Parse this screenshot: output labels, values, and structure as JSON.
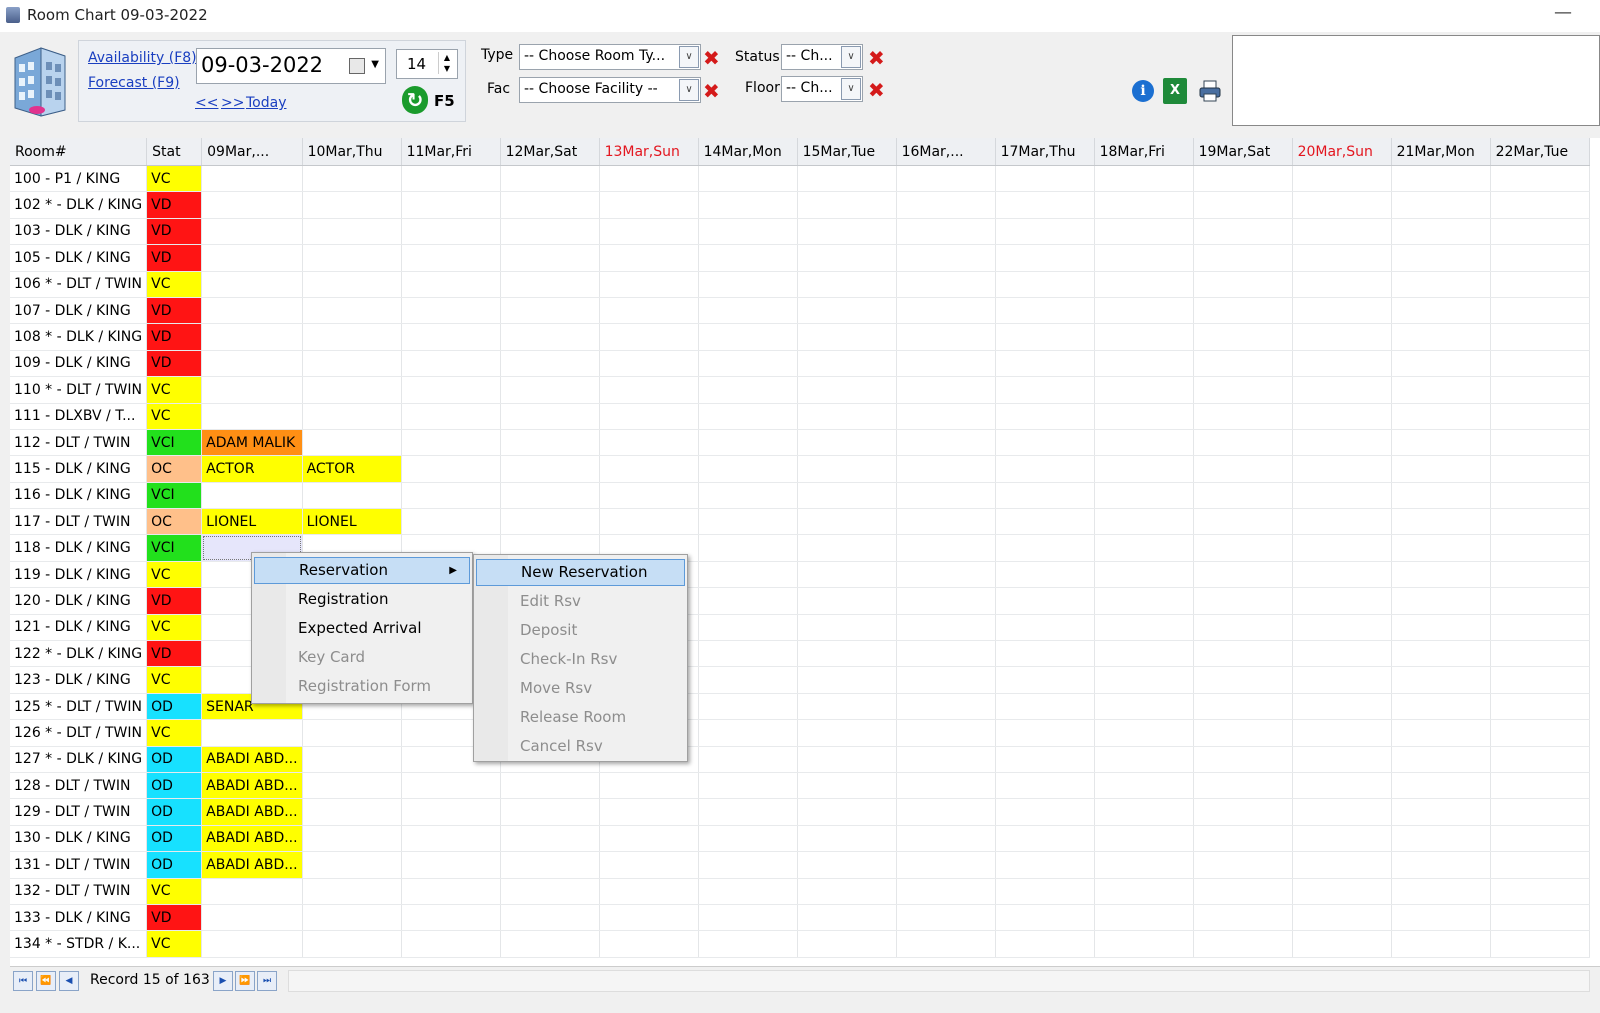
{
  "window": {
    "title": "Room Chart 09-03-2022"
  },
  "nav": {
    "availability": "Availability (F8)",
    "forecast": "Forecast (F9)",
    "prev": "<<",
    "next": ">>",
    "today": "Today",
    "date": "09-03-2022",
    "days": "14",
    "refresh_key": "F5"
  },
  "filters": {
    "type_label": "Type",
    "type_value": "-- Choose Room Ty...",
    "fac_label": "Fac",
    "fac_value": "-- Choose Facility --",
    "status_label": "Status",
    "status_value": "-- Ch...",
    "floor_label": "Floor",
    "floor_value": "-- Ch..."
  },
  "colors": {
    "VC": "#ffff00",
    "VD": "#ff1414",
    "VCI": "#22e01c",
    "OC": "#ffc08a",
    "OD": "#17e1ff",
    "guest_orange": "#ff8f14",
    "guest_yellow": "#ffff00",
    "weekend": "#e3161f"
  },
  "grid": {
    "room_header": "Room#",
    "stat_header": "Stat",
    "dates": [
      {
        "label": "09Mar,...",
        "weekend": false
      },
      {
        "label": "10Mar,Thu",
        "weekend": false
      },
      {
        "label": "11Mar,Fri",
        "weekend": false
      },
      {
        "label": "12Mar,Sat",
        "weekend": false
      },
      {
        "label": "13Mar,Sun",
        "weekend": true
      },
      {
        "label": "14Mar,Mon",
        "weekend": false
      },
      {
        "label": "15Mar,Tue",
        "weekend": false
      },
      {
        "label": "16Mar,...",
        "weekend": false
      },
      {
        "label": "17Mar,Thu",
        "weekend": false
      },
      {
        "label": "18Mar,Fri",
        "weekend": false
      },
      {
        "label": "19Mar,Sat",
        "weekend": false
      },
      {
        "label": "20Mar,Sun",
        "weekend": true
      },
      {
        "label": "21Mar,Mon",
        "weekend": false
      },
      {
        "label": "22Mar,Tue",
        "weekend": false
      }
    ],
    "rows": [
      {
        "room": "100 - P1 / KING",
        "stat": "VC",
        "cells": []
      },
      {
        "room": "102 * - DLK / KING",
        "stat": "VD",
        "cells": []
      },
      {
        "room": "103 - DLK / KING",
        "stat": "VD",
        "cells": []
      },
      {
        "room": "105 - DLK / KING",
        "stat": "VD",
        "cells": []
      },
      {
        "room": "106 * - DLT / TWIN",
        "stat": "VC",
        "cells": []
      },
      {
        "room": "107 - DLK / KING",
        "stat": "VD",
        "cells": []
      },
      {
        "room": "108 * - DLK / KING",
        "stat": "VD",
        "cells": []
      },
      {
        "room": "109 - DLK / KING",
        "stat": "VD",
        "cells": []
      },
      {
        "room": "110 * - DLT / TWIN",
        "stat": "VC",
        "cells": []
      },
      {
        "room": "111 - DLXBV / T...",
        "stat": "VC",
        "cells": []
      },
      {
        "room": "112 - DLT / TWIN",
        "stat": "VCI",
        "cells": [
          {
            "col": 0,
            "text": "ADAM MALIK",
            "color": "orange"
          }
        ]
      },
      {
        "room": "115 - DLK / KING",
        "stat": "OC",
        "cells": [
          {
            "col": 0,
            "text": "ACTOR",
            "color": "yellow"
          },
          {
            "col": 1,
            "text": "ACTOR",
            "color": "yellow"
          }
        ]
      },
      {
        "room": "116 - DLK / KING",
        "stat": "VCI",
        "cells": []
      },
      {
        "room": "117 - DLT / TWIN",
        "stat": "OC",
        "cells": [
          {
            "col": 0,
            "text": "LIONEL",
            "color": "yellow"
          },
          {
            "col": 1,
            "text": "LIONEL",
            "color": "yellow"
          }
        ]
      },
      {
        "room": "118 - DLK / KING",
        "stat": "VCI",
        "cells": [
          {
            "col": 0,
            "text": "",
            "color": "selected"
          }
        ]
      },
      {
        "room": "119 - DLK / KING",
        "stat": "VC",
        "cells": []
      },
      {
        "room": "120 - DLK / KING",
        "stat": "VD",
        "cells": []
      },
      {
        "room": "121 - DLK / KING",
        "stat": "VC",
        "cells": []
      },
      {
        "room": "122 * - DLK / KING",
        "stat": "VD",
        "cells": []
      },
      {
        "room": "123 - DLK / KING",
        "stat": "VC",
        "cells": []
      },
      {
        "room": "125 * - DLT / TWIN",
        "stat": "OD",
        "cells": [
          {
            "col": 0,
            "text": "SENAR",
            "color": "yellow"
          }
        ]
      },
      {
        "room": "126 * - DLT / TWIN",
        "stat": "VC",
        "cells": []
      },
      {
        "room": "127 * - DLK / KING",
        "stat": "OD",
        "cells": [
          {
            "col": 0,
            "text": "ABADI ABD...",
            "color": "yellow"
          }
        ]
      },
      {
        "room": "128 - DLT / TWIN",
        "stat": "OD",
        "cells": [
          {
            "col": 0,
            "text": "ABADI ABD...",
            "color": "yellow"
          }
        ]
      },
      {
        "room": "129 - DLT / TWIN",
        "stat": "OD",
        "cells": [
          {
            "col": 0,
            "text": "ABADI ABD...",
            "color": "yellow"
          }
        ]
      },
      {
        "room": "130 - DLK / KING",
        "stat": "OD",
        "cells": [
          {
            "col": 0,
            "text": "ABADI ABD...",
            "color": "yellow"
          }
        ]
      },
      {
        "room": "131 - DLT / TWIN",
        "stat": "OD",
        "cells": [
          {
            "col": 0,
            "text": "ABADI ABD...",
            "color": "yellow"
          }
        ]
      },
      {
        "room": "132 - DLT / TWIN",
        "stat": "VC",
        "cells": []
      },
      {
        "room": "133 - DLK / KING",
        "stat": "VD",
        "cells": []
      },
      {
        "room": "134 * - STDR / K...",
        "stat": "VC",
        "cells": []
      }
    ]
  },
  "status_bar": {
    "record": "Record 15 of 163"
  },
  "context_menu": {
    "items": [
      {
        "label": "Reservation",
        "enabled": true,
        "submenu": true,
        "highlighted": true
      },
      {
        "label": "Registration",
        "enabled": true
      },
      {
        "label": "Expected Arrival",
        "enabled": true
      },
      {
        "label": "Key Card",
        "enabled": false
      },
      {
        "label": "Registration Form",
        "enabled": false
      }
    ]
  },
  "submenu": {
    "items": [
      {
        "label": "New Reservation",
        "enabled": true,
        "highlighted": true
      },
      {
        "label": "Edit Rsv",
        "enabled": false
      },
      {
        "label": "Deposit",
        "enabled": false
      },
      {
        "label": "Check-In Rsv",
        "enabled": false
      },
      {
        "label": "Move Rsv",
        "enabled": false
      },
      {
        "label": "Release Room",
        "enabled": false
      },
      {
        "label": "Cancel Rsv",
        "enabled": false
      }
    ]
  }
}
